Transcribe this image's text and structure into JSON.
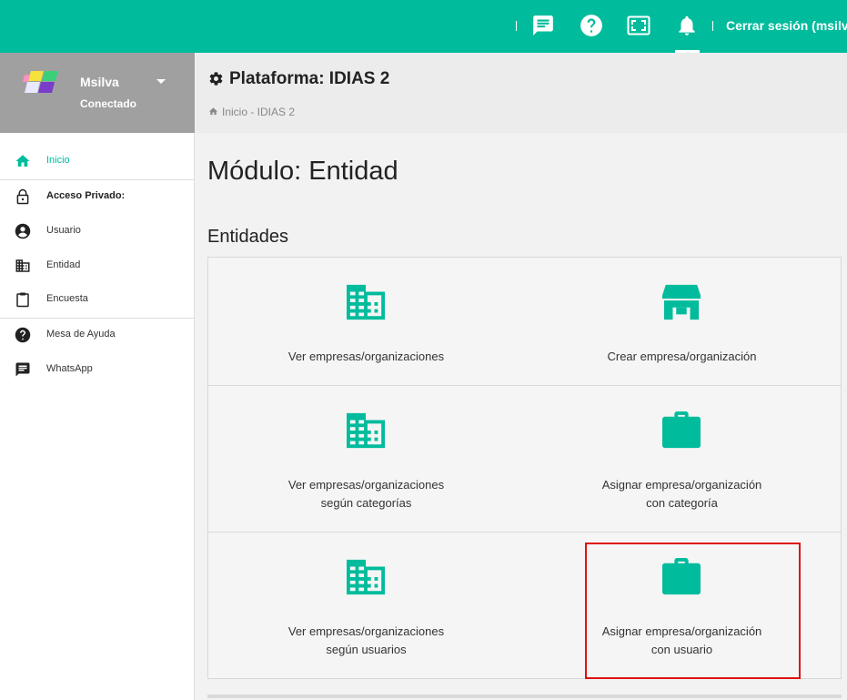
{
  "topbar": {
    "logout_label": "Cerrar sesión (msilva)",
    "icons": [
      "chat-icon",
      "help-icon",
      "fullscreen-icon",
      "bell-icon"
    ],
    "color": "#00bc9c"
  },
  "user": {
    "name": "Msilva",
    "status": "Conectado"
  },
  "sidebar": {
    "items": [
      {
        "label": "Inicio",
        "icon": "home-icon",
        "active": true
      },
      {
        "label": "Acceso Privado:",
        "icon": "lock-icon"
      },
      {
        "label": "Usuario",
        "icon": "user-icon"
      },
      {
        "label": "Entidad",
        "icon": "building-icon"
      },
      {
        "label": "Encuesta",
        "icon": "clipboard-icon"
      },
      {
        "label": "Mesa de Ayuda",
        "icon": "help-icon"
      },
      {
        "label": "WhatsApp",
        "icon": "chat-icon"
      }
    ]
  },
  "header": {
    "title": "Plataforma: IDIAS 2",
    "breadcrumb": "Inicio - IDIAS 2"
  },
  "main": {
    "module_title": "Módulo: Entidad",
    "section_title": "Entidades",
    "cards": [
      {
        "line1": "Ver empresas/organizaciones",
        "line2": "",
        "icon": "building-icon"
      },
      {
        "line1": "Crear empresa/organización",
        "line2": "",
        "icon": "store-icon"
      },
      {
        "line1": "Ver empresas/organizaciones",
        "line2": "según categorías",
        "icon": "building-icon"
      },
      {
        "line1": "Asignar empresa/organización",
        "line2": "con categoría",
        "icon": "briefcase-icon"
      },
      {
        "line1": "Ver empresas/organizaciones",
        "line2": "según usuarios",
        "icon": "building-icon"
      },
      {
        "line1": "Asignar empresa/organización",
        "line2": "con usuario",
        "icon": "briefcase-icon"
      }
    ]
  }
}
